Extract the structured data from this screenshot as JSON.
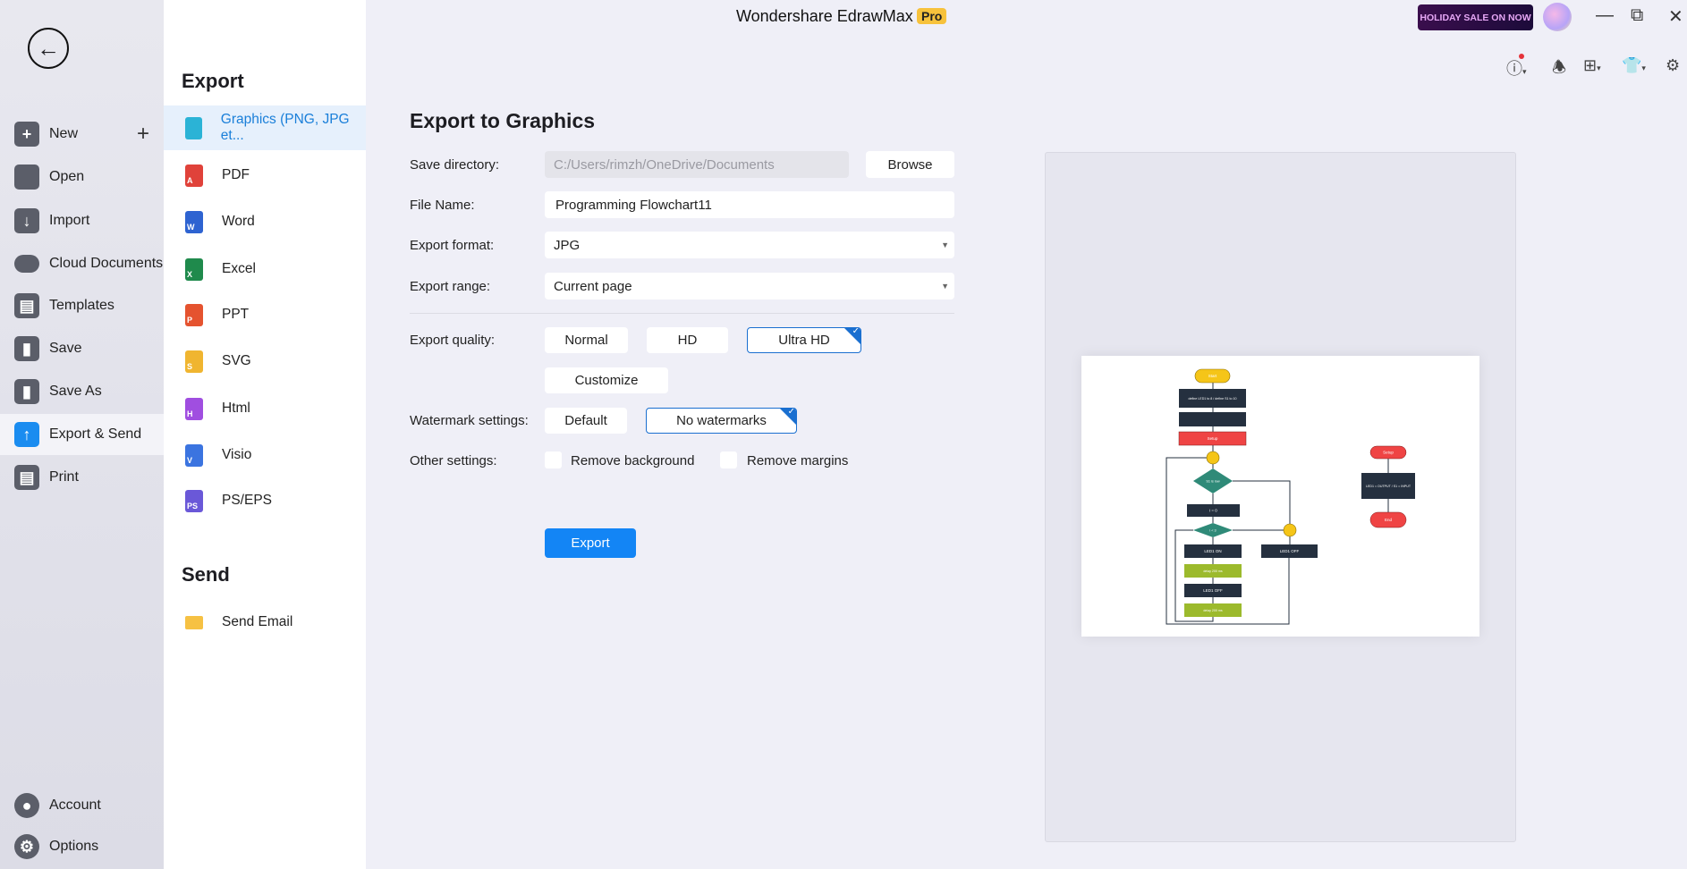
{
  "app": {
    "title": "Wondershare EdrawMax",
    "badge": "Pro",
    "promo": "HOLIDAY SALE ON NOW"
  },
  "sidebar": {
    "items": [
      {
        "label": "New",
        "icon": "plus-square-icon"
      },
      {
        "label": "Open",
        "icon": "folder-icon"
      },
      {
        "label": "Import",
        "icon": "import-icon"
      },
      {
        "label": "Cloud Documents",
        "icon": "cloud-icon"
      },
      {
        "label": "Templates",
        "icon": "templates-icon"
      },
      {
        "label": "Save",
        "icon": "save-icon"
      },
      {
        "label": "Save As",
        "icon": "save-as-icon"
      },
      {
        "label": "Export & Send",
        "icon": "export-icon",
        "active": true
      },
      {
        "label": "Print",
        "icon": "print-icon"
      }
    ],
    "bottom": [
      {
        "label": "Account",
        "icon": "account-icon"
      },
      {
        "label": "Options",
        "icon": "gear-icon"
      }
    ]
  },
  "export_menu": {
    "heading": "Export",
    "items": [
      {
        "label": "Graphics (PNG, JPG et...",
        "color": "#2bb3d6",
        "letter": "",
        "active": true
      },
      {
        "label": "PDF",
        "color": "#e0423a",
        "letter": "A"
      },
      {
        "label": "Word",
        "color": "#2e63d1",
        "letter": "W"
      },
      {
        "label": "Excel",
        "color": "#1f8a4c",
        "letter": "X"
      },
      {
        "label": "PPT",
        "color": "#e5532f",
        "letter": "P"
      },
      {
        "label": "SVG",
        "color": "#f0b530",
        "letter": "S"
      },
      {
        "label": "Html",
        "color": "#a04ee0",
        "letter": "H"
      },
      {
        "label": "Visio",
        "color": "#3b74e0",
        "letter": "V"
      },
      {
        "label": "PS/EPS",
        "color": "#6a58d8",
        "letter": "PS"
      }
    ],
    "send_heading": "Send",
    "send_items": [
      {
        "label": "Send Email",
        "icon": "email-icon"
      }
    ]
  },
  "form": {
    "heading": "Export to Graphics",
    "save_dir_label": "Save directory:",
    "save_dir_value": "C:/Users/rimzh/OneDrive/Documents",
    "browse": "Browse",
    "file_name_label": "File Name:",
    "file_name_value": "Programming Flowchart11",
    "format_label": "Export format:",
    "format_value": "JPG",
    "range_label": "Export range:",
    "range_value": "Current page",
    "quality_label": "Export quality:",
    "quality_options": [
      "Normal",
      "HD",
      "Ultra HD"
    ],
    "quality_selected": "Ultra HD",
    "customize": "Customize",
    "watermark_label": "Watermark settings:",
    "watermark_options": [
      "Default",
      "No watermarks"
    ],
    "watermark_selected": "No watermarks",
    "other_label": "Other settings:",
    "remove_background": "Remove background",
    "remove_margins": "Remove margins",
    "remove_background_checked": false,
    "remove_margins_checked": false,
    "export_button": "Export"
  },
  "preview": {
    "nodes": [
      "Start",
      "define LED1 to 8 / define S1 to 10",
      "Setup",
      "S1 is low",
      "i = 0",
      "i < 3",
      "LED1 ON",
      "delay 200 ms",
      "LED1 OFF",
      "delay 200 ms",
      "LED1 OFF",
      "Setup",
      "LED1 = OUTPUT / S1 = INPUT",
      "End"
    ]
  },
  "colors": {
    "accent": "#1385f5",
    "selected": "#1a6fd0",
    "flow_dark": "#25303f",
    "flow_red": "#ef4444",
    "flow_yellow": "#f5c518",
    "flow_teal": "#2f8a78",
    "flow_green": "#9cba2c"
  }
}
